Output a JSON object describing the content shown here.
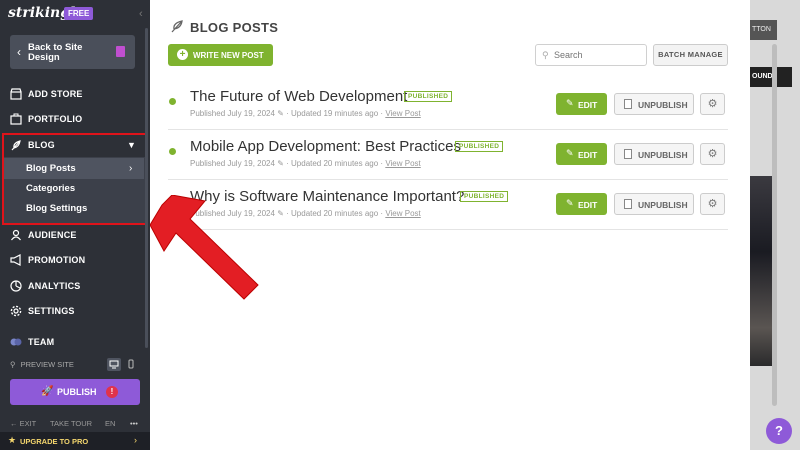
{
  "brand": {
    "logo": "strikingly",
    "plan_badge": "FREE"
  },
  "sidebar": {
    "back_label": "Back to Site Design",
    "items": [
      {
        "label": "ADD STORE",
        "icon": "store-icon"
      },
      {
        "label": "PORTFOLIO",
        "icon": "portfolio-icon"
      },
      {
        "label": "BLOG",
        "icon": "feather-icon"
      },
      {
        "label": "AUDIENCE",
        "icon": "audience-icon"
      },
      {
        "label": "PROMOTION",
        "icon": "megaphone-icon"
      },
      {
        "label": "ANALYTICS",
        "icon": "analytics-icon"
      },
      {
        "label": "SETTINGS",
        "icon": "gear-icon"
      },
      {
        "label": "TEAM",
        "icon": "team-icon"
      }
    ],
    "blog_sub": [
      "Blog Posts",
      "Categories",
      "Blog Settings"
    ],
    "preview_label": "PREVIEW SITE",
    "publish_label": "PUBLISH",
    "publish_alert": "!",
    "footer": {
      "exit": "EXIT",
      "tour": "TAKE TOUR",
      "lang": "EN",
      "more": "•••"
    },
    "upgrade_label": "UPGRADE TO PRO"
  },
  "main": {
    "title": "BLOG POSTS",
    "write_label": "WRITE NEW POST",
    "search_placeholder": "Search",
    "batch_label": "BATCH MANAGE",
    "posts": [
      {
        "title": "The Future of Web Development",
        "status": "PUBLISHED",
        "published": "Published July 19, 2024",
        "updated": "· Updated 19 minutes ago ·",
        "view": "View Post"
      },
      {
        "title": "Mobile App Development: Best Practices",
        "status": "PUBLISHED",
        "published": "Published July 19, 2024",
        "updated": "· Updated 20 minutes ago ·",
        "view": "View Post"
      },
      {
        "title": "Why is Software Maintenance Important?",
        "status": "PUBLISHED",
        "published": "Published July 19, 2024",
        "updated": "· Updated 20 minutes ago ·",
        "view": "View Post"
      }
    ],
    "edit_label": "EDIT",
    "unpublish_label": "UNPUBLISH"
  },
  "background": {
    "button_fragment": "TTON",
    "bg_fragment": "OUND"
  },
  "help_label": "?",
  "colors": {
    "accent_green": "#7fb32f",
    "purple": "#8e5ad8",
    "sidebar": "#2d3037",
    "highlight_red": "#e0131a"
  }
}
